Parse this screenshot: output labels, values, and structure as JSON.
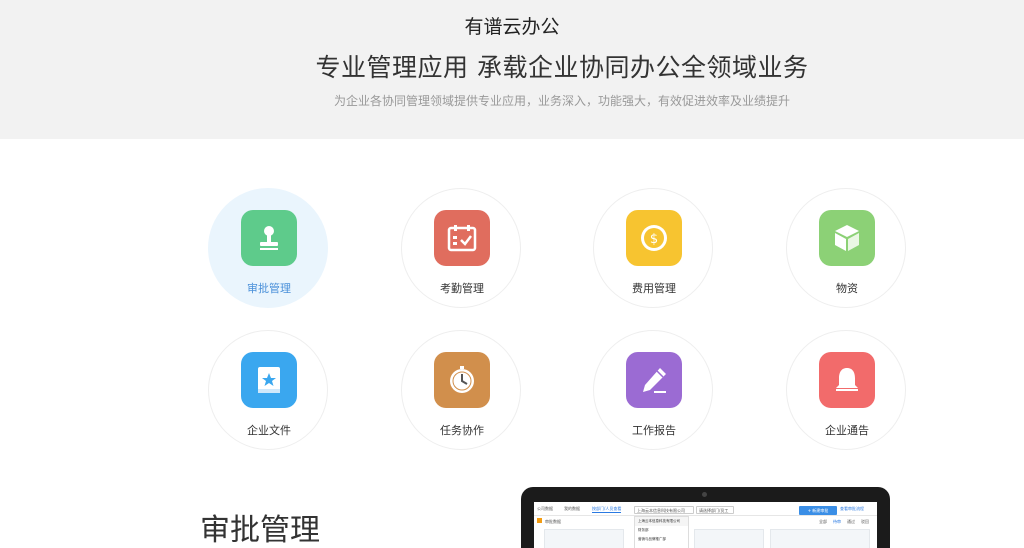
{
  "hero": {
    "brand": "有谱云办公",
    "headline": "专业管理应用 承载企业协同办公全领域业务",
    "subline": "为企业各协同管理领域提供专业应用，业务深入，功能强大，有效促进效率及业绩提升"
  },
  "modules": [
    {
      "label": "审批管理",
      "icon": "stamp-icon",
      "color": "#5ecb8b",
      "active": true
    },
    {
      "label": "考勤管理",
      "icon": "calendar-check-icon",
      "color": "#e06d5e"
    },
    {
      "label": "费用管理",
      "icon": "coin-icon",
      "color": "#f7c430"
    },
    {
      "label": "物资",
      "icon": "box-icon",
      "color": "#8cd176"
    },
    {
      "label": "企业文件",
      "icon": "book-star-icon",
      "color": "#3aa7ef"
    },
    {
      "label": "任务协作",
      "icon": "clock-icon",
      "color": "#d18f4c"
    },
    {
      "label": "工作报告",
      "icon": "pencil-icon",
      "color": "#9b6bd3"
    },
    {
      "label": "企业通告",
      "icon": "bell-icon",
      "color": "#f26b6b"
    }
  ],
  "section": {
    "title": "审批管理"
  },
  "screen": {
    "tabs": [
      "公司数据",
      "我的数据",
      "按部门/人员查看"
    ],
    "company_select": "上海云本信息科技有限公司",
    "dept_select": "请选择部门/员工",
    "new_button": "+ 新建审批",
    "link": "查看审批流程",
    "sub_title": "审批数据",
    "sub_right": [
      "全部",
      "待审",
      "通过",
      "驳回"
    ],
    "dropdown": [
      "上海云本信息科技有限公司",
      "财务部",
      "营销与品牌推广部"
    ]
  },
  "colors": {
    "active_label": "#4a90d9",
    "hero_bg": "#f2f2f2",
    "active_bg": "#eaf5fd"
  }
}
